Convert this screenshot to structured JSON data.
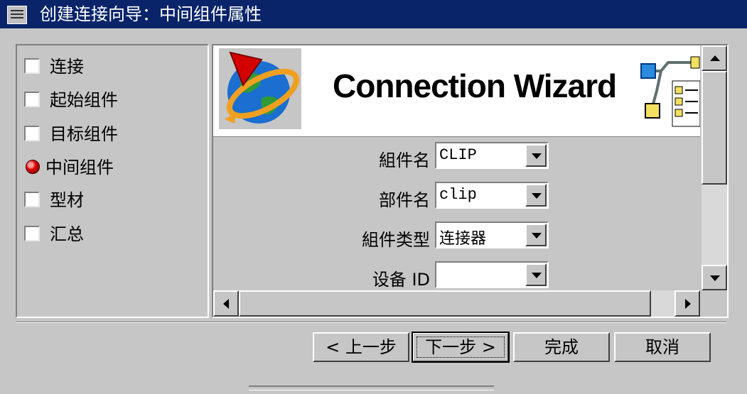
{
  "window": {
    "title": "创建连接向导：中间组件属性"
  },
  "steps": [
    {
      "label": "连接",
      "state": "unchecked"
    },
    {
      "label": "起始组件",
      "state": "unchecked"
    },
    {
      "label": "目标组件",
      "state": "unchecked"
    },
    {
      "label": "中间组件",
      "state": "active"
    },
    {
      "label": "型材",
      "state": "unchecked"
    },
    {
      "label": "汇总",
      "state": "unchecked"
    }
  ],
  "banner": {
    "title": "Connection Wizard"
  },
  "fields": [
    {
      "label": "組件名",
      "value": "CLIP"
    },
    {
      "label": "部件名",
      "value": "clip"
    },
    {
      "label": "組件类型",
      "value": "连接器"
    },
    {
      "label": "设备 ID",
      "value": ""
    }
  ],
  "buttons": {
    "back": "< 上一步",
    "next": "下一步 >",
    "finish": "完成",
    "cancel": "取消"
  },
  "colors": {
    "titlebar": "#0a246a",
    "face": "#c6c6c6",
    "active_step": "#e00000"
  }
}
